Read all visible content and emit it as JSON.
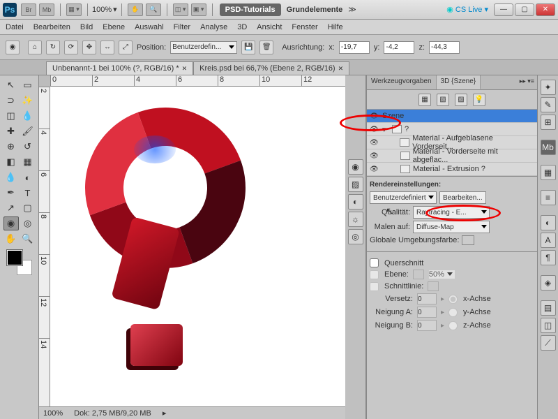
{
  "titlebar": {
    "app": "PSD-Tutorials",
    "doc": "Grundelemente",
    "zoom": "100%",
    "br": "Br",
    "mb": "Mb",
    "cslive": "CS Live ▾"
  },
  "menu": [
    "Datei",
    "Bearbeiten",
    "Bild",
    "Ebene",
    "Auswahl",
    "Filter",
    "Analyse",
    "3D",
    "Ansicht",
    "Fenster",
    "Hilfe"
  ],
  "optbar": {
    "position_lbl": "Position:",
    "position_val": "Benutzerdefin...",
    "ausrichtung": "Ausrichtung:",
    "x": "-19,7",
    "y": "-4,2",
    "z": "-44,3"
  },
  "doctabs": [
    {
      "label": "Unbenannt-1 bei 100% (?, RGB/16) *",
      "active": true
    },
    {
      "label": "Kreis.psd bei 66,7% (Ebene 2, RGB/16)",
      "active": false
    }
  ],
  "ruler_h": [
    "0",
    "2",
    "4",
    "6",
    "8",
    "10",
    "12"
  ],
  "ruler_v": [
    "2",
    "4",
    "6",
    "8",
    "10",
    "12",
    "14"
  ],
  "panel": {
    "tab1": "Werkzeugvorgaben",
    "tab2": "3D {Szene}"
  },
  "scene": [
    {
      "label": "Szene",
      "sel": true
    },
    {
      "label": "?",
      "sel": false,
      "indent": 1
    },
    {
      "label": "Material - Aufgeblasene Vorderseit...",
      "sel": false,
      "indent": 2
    },
    {
      "label": "Material - Vorderseite mit abgeflac...",
      "sel": false,
      "indent": 2
    },
    {
      "label": "Material - Extrusion ?",
      "sel": false,
      "indent": 2
    }
  ],
  "render": {
    "title": "Rendereinstellungen:",
    "preset": "Benutzerdefiniert",
    "edit": "Bearbeiten...",
    "quality_lbl": "Qualität:",
    "quality": "Raytracing - E...",
    "paint_lbl": "Malen auf:",
    "paint": "Diffuse-Map",
    "global": "Globale Umgebungsfarbe:"
  },
  "cross": {
    "title": "Querschnitt",
    "ebene": "Ebene:",
    "pct": "50%",
    "schnitt": "Schnittlinie:",
    "versetz": "Versetz:",
    "v0": "0",
    "ax": "x-Achse",
    "neigA": "Neigung A:",
    "a0": "0",
    "ay": "y-Achse",
    "neigB": "Neigung B:",
    "b0": "0",
    "az": "z-Achse"
  },
  "status": {
    "zoom": "100%",
    "dok": "Dok: 2,75 MB/9,20 MB"
  }
}
